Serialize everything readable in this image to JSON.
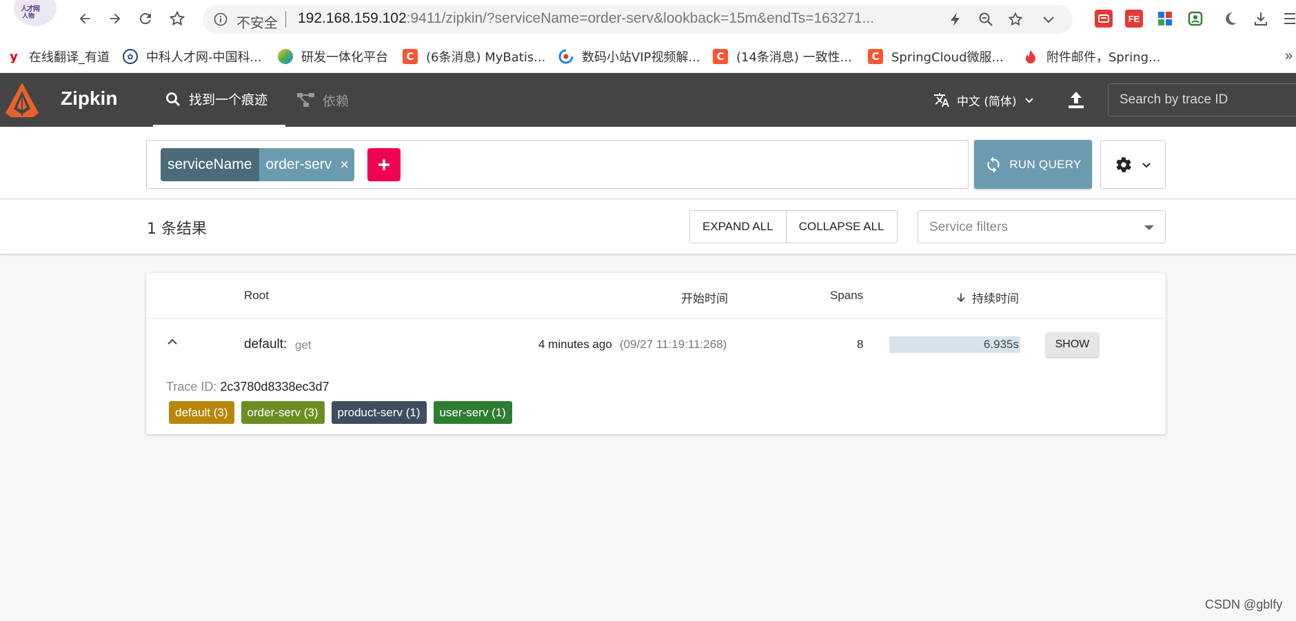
{
  "browser": {
    "insecure_label": "不安全",
    "url_host": "192.168.159.102",
    "url_rest": ":9411/zipkin/?serviceName=order-serv&lookback=15m&endTs=163271...",
    "bookmarks": [
      {
        "label": "在线翻译_有道",
        "icon": "youdao-icon",
        "color": "#e60012"
      },
      {
        "label": "中科人才网-中国科...",
        "icon": "cas-icon",
        "color": "#1a3a8f"
      },
      {
        "label": "研发一体化平台",
        "icon": "platform-icon",
        "color": "#4caf50"
      },
      {
        "label": "(6条消息) MyBatis...",
        "icon": "csdn-icon",
        "color": "#fc5531"
      },
      {
        "label": "数码小站VIP视频解...",
        "icon": "video-icon",
        "color": "#1e88e5"
      },
      {
        "label": "(14条消息) 一致性...",
        "icon": "csdn-icon",
        "color": "#fc5531"
      },
      {
        "label": "SpringCloud微服...",
        "icon": "csdn-icon",
        "color": "#fc5531"
      },
      {
        "label": "附件邮件，Spring...",
        "icon": "fire-icon",
        "color": "#e53935"
      }
    ],
    "more": "»"
  },
  "header": {
    "title": "Zipkin",
    "tab_find": "找到一个痕迹",
    "tab_deps": "依赖",
    "language": "中文 (简体)",
    "search_placeholder": "Search by trace ID"
  },
  "query": {
    "chip_key": "serviceName",
    "chip_value": "order-serv",
    "chip_remove": "×",
    "run_label": "RUN QUERY"
  },
  "results": {
    "count_label": "1 条结果",
    "expand_all": "EXPAND ALL",
    "collapse_all": "COLLAPSE ALL",
    "service_filter_placeholder": "Service filters"
  },
  "table": {
    "headers": {
      "root": "Root",
      "start": "开始时间",
      "spans": "Spans",
      "duration": "持续时间"
    },
    "row": {
      "service": "default:",
      "span": "get",
      "start_relative": "4 minutes ago",
      "start_absolute": "(09/27 11:19:11:268)",
      "spans": "8",
      "duration": "6.935s",
      "duration_fraction": 1.0,
      "show_label": "SHOW",
      "trace_id_label": "Trace ID:",
      "trace_id": "2c3780d8338ec3d7",
      "services": [
        {
          "label": "default (3)",
          "color": "#b8860b"
        },
        {
          "label": "order-serv (3)",
          "color": "#6b8e23"
        },
        {
          "label": "product-serv (1)",
          "color": "#3d4f5f"
        },
        {
          "label": "user-serv (1)",
          "color": "#2e7d32"
        }
      ]
    }
  },
  "watermark": "CSDN @gblfy",
  "colors": {
    "header_bg": "#444444",
    "accent_pink": "#f00055",
    "accent_blue": "#6b9bb0",
    "chip_key": "#4b6b7b",
    "logo_orange": "#e8622c"
  }
}
